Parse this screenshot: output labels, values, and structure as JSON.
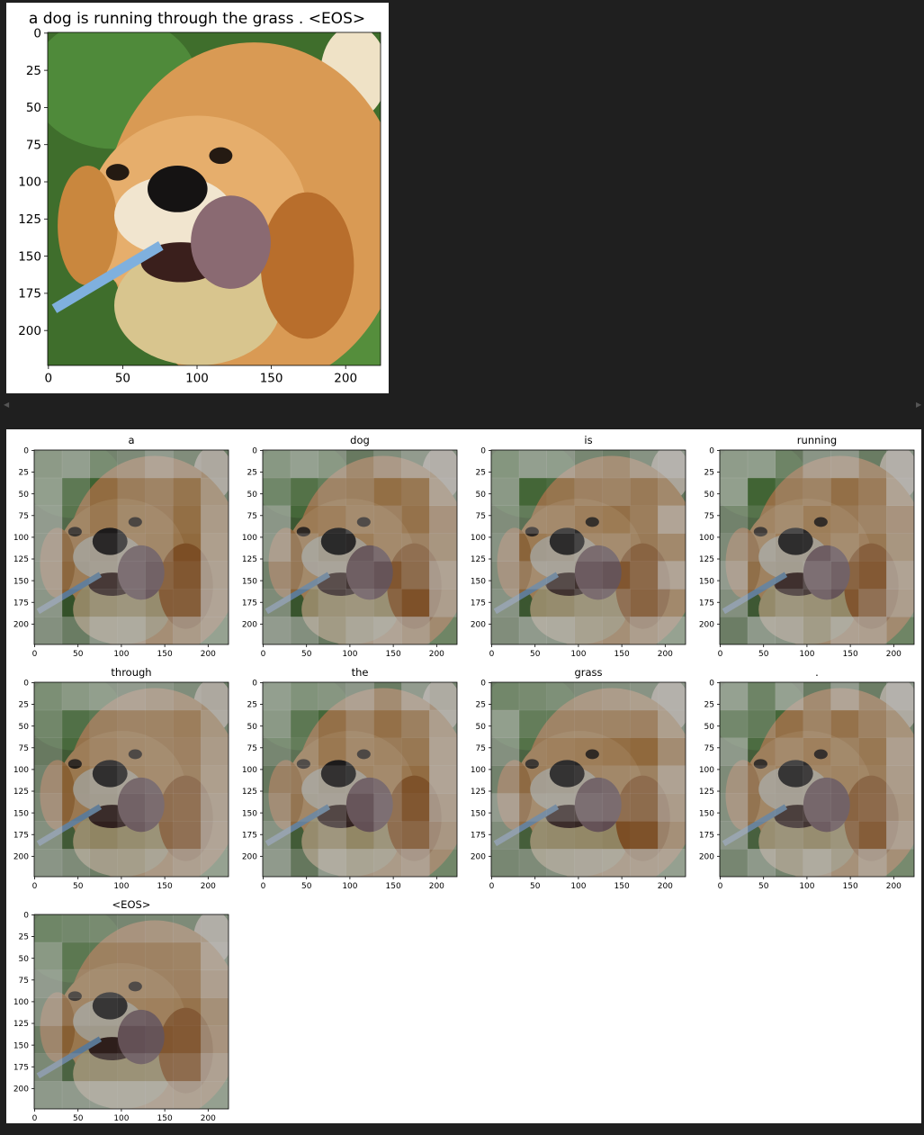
{
  "caption": "a dog is running through the grass . <EOS>",
  "axis": {
    "y_ticks": [
      "0",
      "25",
      "50",
      "75",
      "100",
      "125",
      "150",
      "175",
      "200"
    ],
    "x_ticks": [
      "0",
      "50",
      "100",
      "150",
      "200"
    ]
  },
  "attention_plots": [
    {
      "word": "a"
    },
    {
      "word": "dog"
    },
    {
      "word": "is"
    },
    {
      "word": "running"
    },
    {
      "word": "through"
    },
    {
      "word": "the"
    },
    {
      "word": "grass"
    },
    {
      "word": "."
    },
    {
      "word": "<EOS>"
    }
  ],
  "scroll": {
    "left_icon": "arrow-left-icon",
    "right_icon": "arrow-right-icon"
  }
}
